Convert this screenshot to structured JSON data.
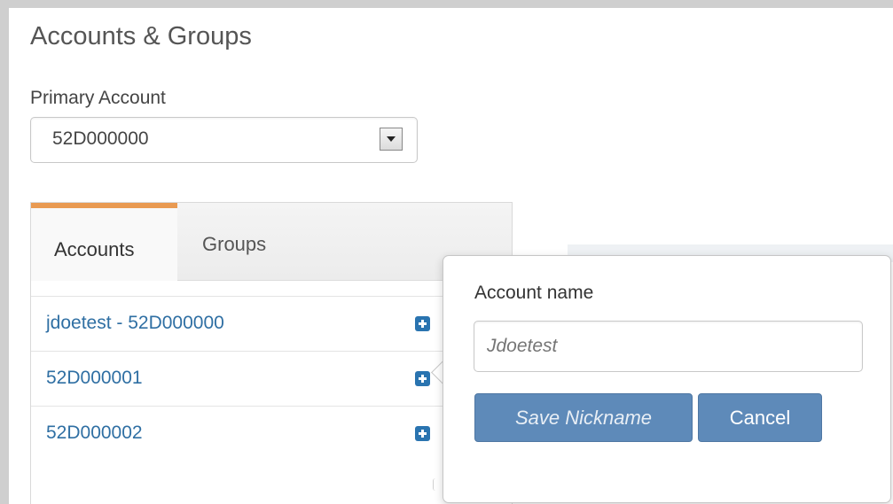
{
  "page": {
    "title": "Accounts & Groups"
  },
  "primary_account": {
    "label": "Primary Account",
    "selected": "52D000000"
  },
  "tabs": [
    {
      "label": "Accounts",
      "active": true
    },
    {
      "label": "Groups",
      "active": false
    }
  ],
  "accounts": [
    {
      "label": "jdoetest - 52D000000",
      "icon": "plus-square-icon"
    },
    {
      "label": "52D000001",
      "icon": "plus-square-icon"
    },
    {
      "label": "52D000002",
      "icon": "plus-square-icon"
    }
  ],
  "popover": {
    "field_label": "Account name",
    "placeholder": "Jdoetest",
    "value": "",
    "save_label": "Save Nickname",
    "cancel_label": "Cancel"
  },
  "colors": {
    "tab_accent": "#e99a52",
    "link": "#2f6fa3",
    "button": "#5e8ab9",
    "icon": "#2a74b0"
  }
}
